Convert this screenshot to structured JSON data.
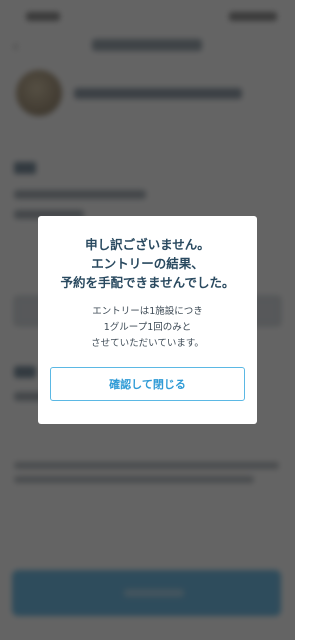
{
  "modal": {
    "title_lines": [
      "申し訳ございません。",
      "エントリーの結果、",
      "予約を手配できませんでした。"
    ],
    "body_lines": [
      "エントリーは1施設につき",
      "1グループ1回のみと",
      "させていただいています。"
    ],
    "confirm_button_label": "確認して閉じる"
  },
  "colors": {
    "overlay": "#282828",
    "modal_title": "#2a4a60",
    "button_accent": "#2f9bd6",
    "background_button": "#3fa8e0"
  }
}
